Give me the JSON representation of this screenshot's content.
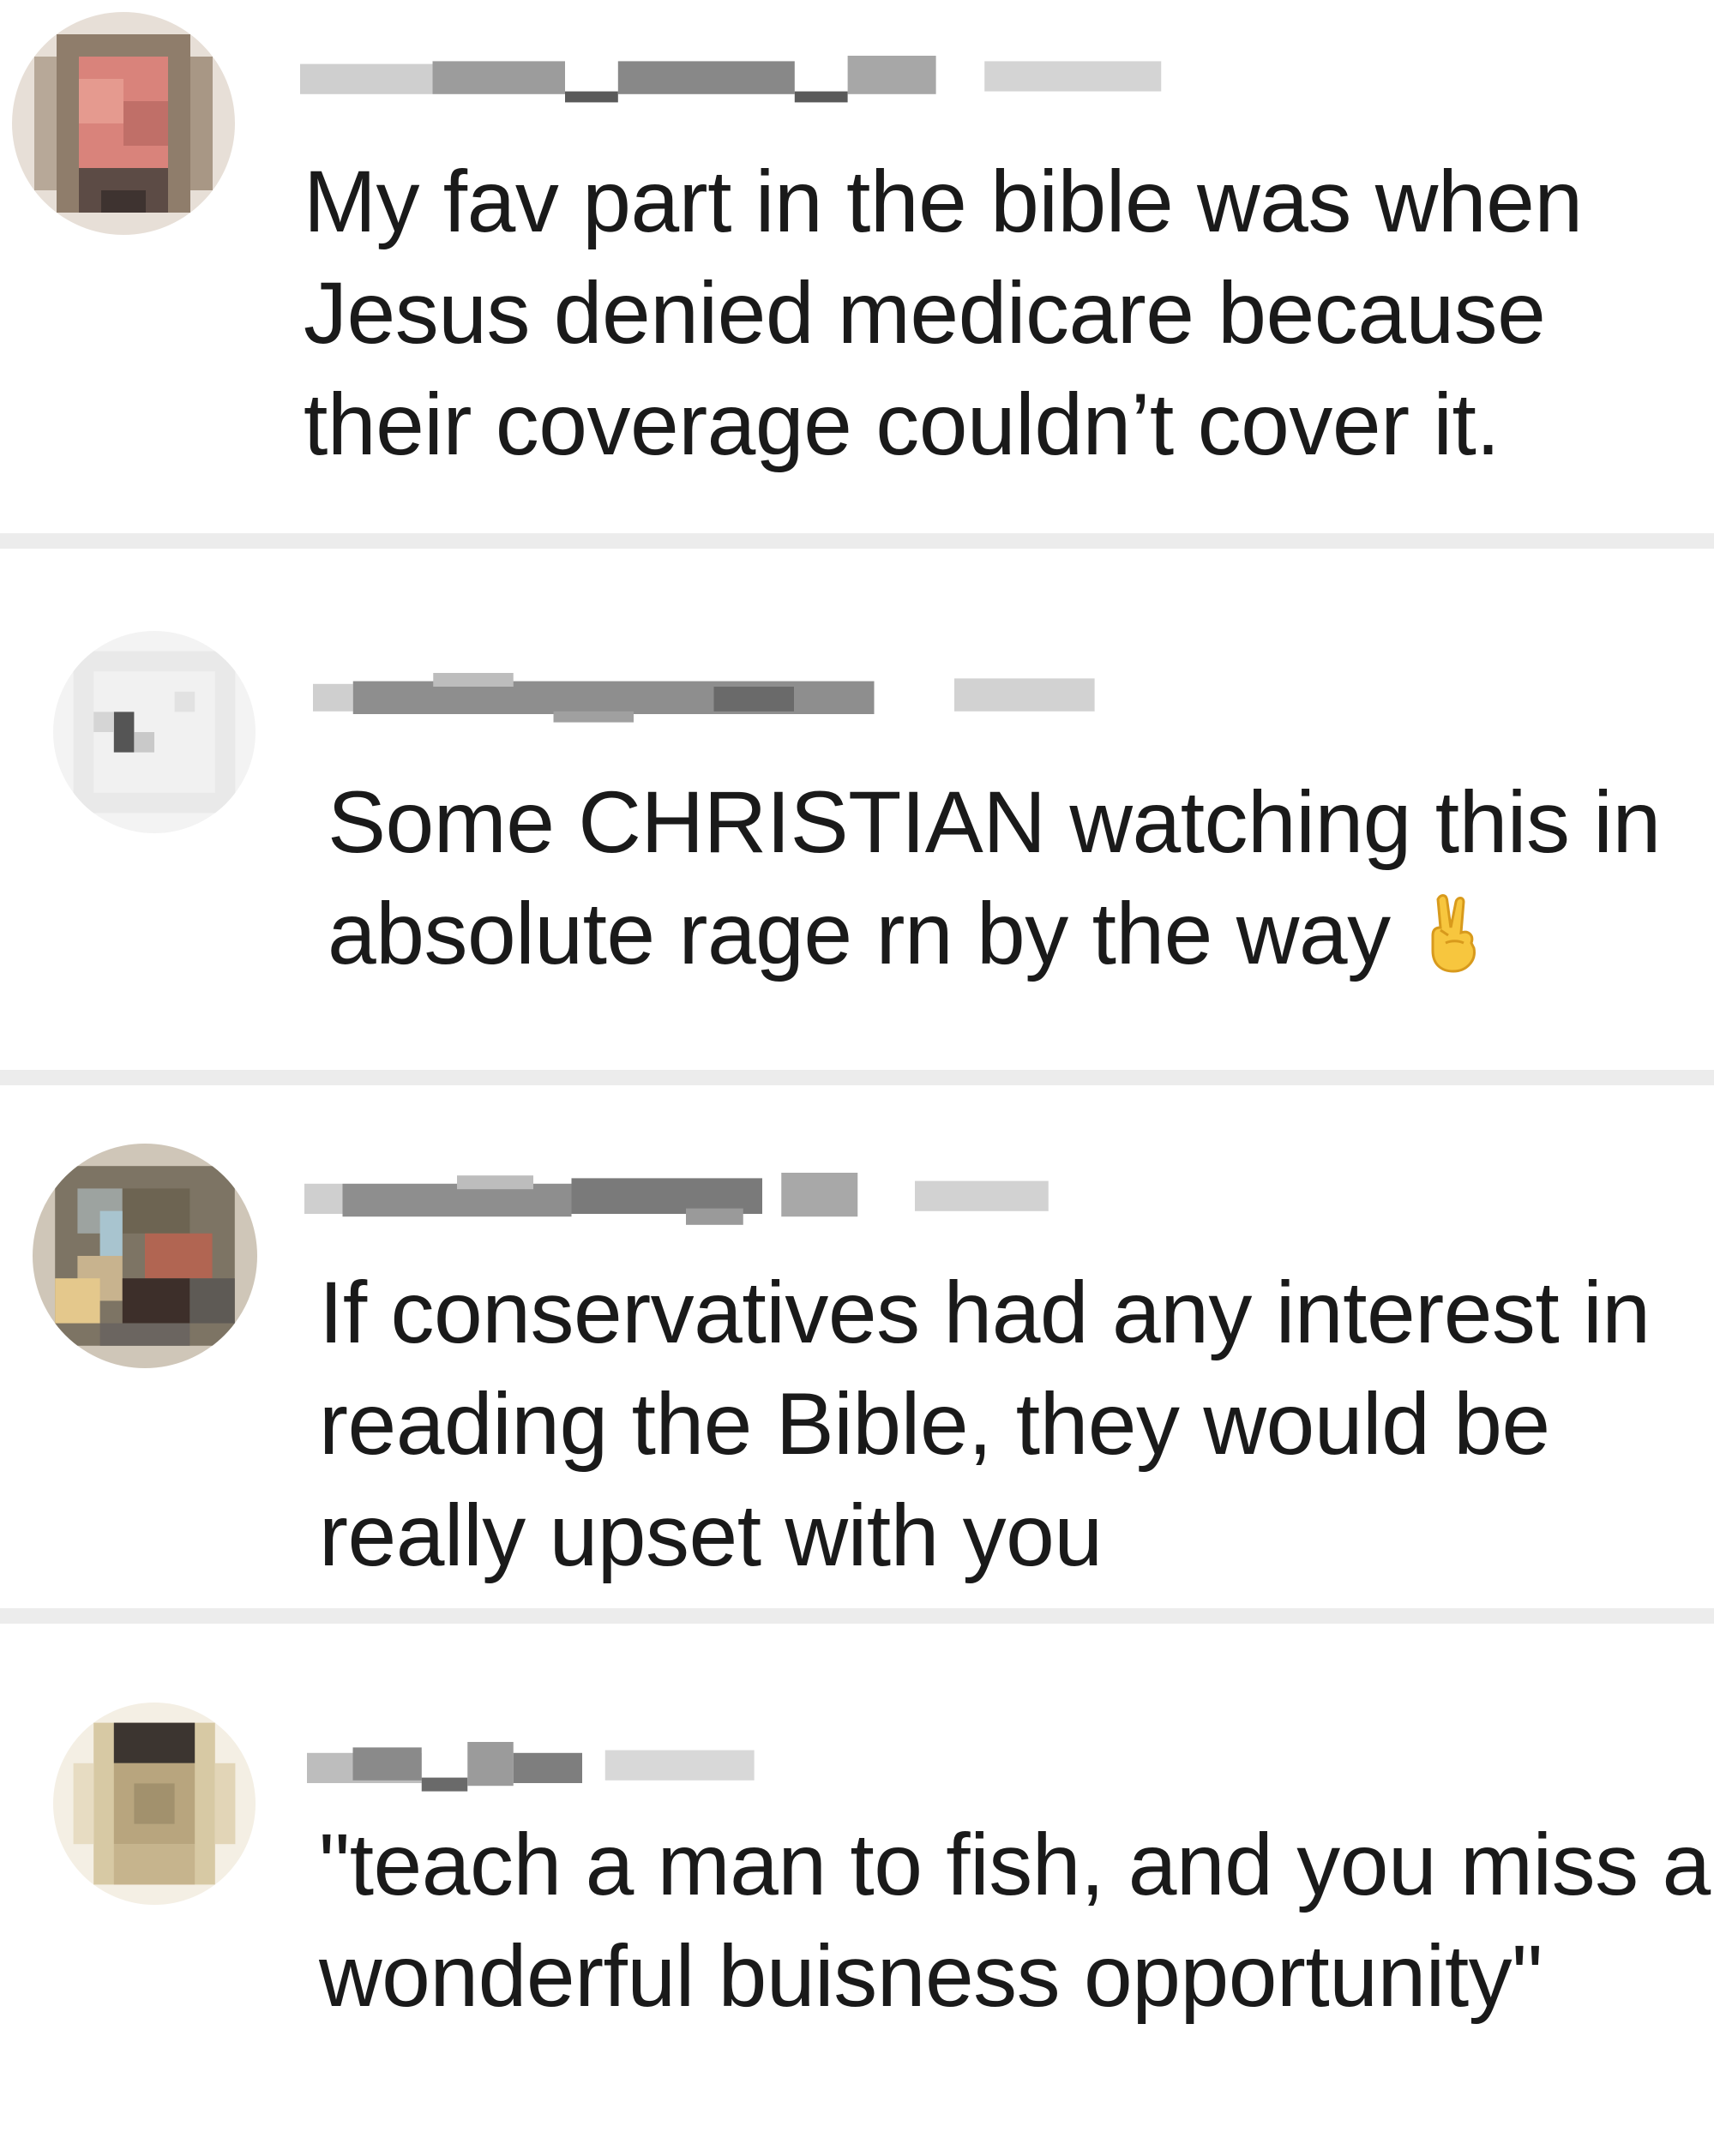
{
  "comments": [
    {
      "id": "comment-1",
      "username": "",
      "timestamp": "",
      "text_lines": [
        "My fav part in the bible was when",
        "Jesus denied medicare because",
        "their coverage couldn’t cover it."
      ]
    },
    {
      "id": "comment-2",
      "username": "",
      "timestamp": "",
      "text_lines": [
        "Some CHRISTIAN watching this in",
        "absolute rage rn by the way"
      ],
      "emoji": "victory-hand-icon"
    },
    {
      "id": "comment-3",
      "username": "",
      "timestamp": "",
      "text_lines": [
        "If conservatives had any interest in",
        "reading the Bible, they would be",
        "really upset with you"
      ]
    },
    {
      "id": "comment-4",
      "username": "",
      "timestamp": "",
      "text_lines": [
        "\"teach a man to fish, and you miss a",
        "wonderful buisness opportunity\""
      ]
    }
  ],
  "colors": {
    "divider": "#ececec",
    "text": "#1a1a1a",
    "background": "#ffffff",
    "blur_gray": "#b8b8b8"
  }
}
